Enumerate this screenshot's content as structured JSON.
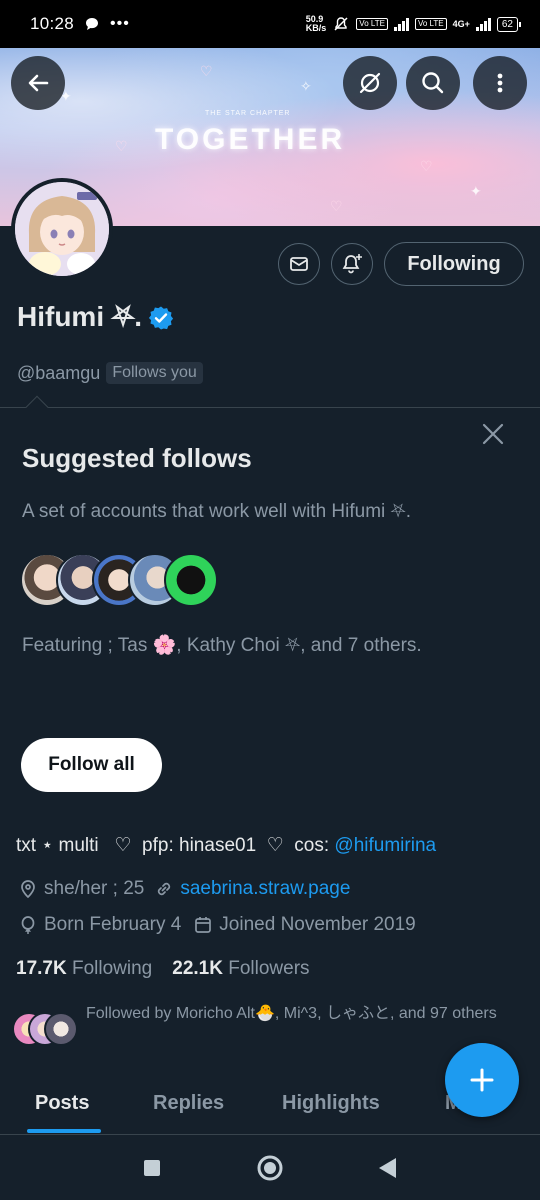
{
  "status_bar": {
    "time": "10:28",
    "net_speed_value": "50.9",
    "net_speed_unit": "KB/s",
    "volte_label": "Vo LTE",
    "network_type": "4G+",
    "battery": "62"
  },
  "banner": {
    "title": "TOGETHER",
    "subtitle": "THE STAR CHAPTER"
  },
  "profile": {
    "display_name": "Hifumi ⛧.",
    "handle": "@baamgu",
    "follows_you_label": "Follows you",
    "following_button_label": "Following"
  },
  "suggested": {
    "title": "Suggested follows",
    "description": "A set of accounts that work well with Hifumi ⛧.",
    "featuring": "Featuring ; Tas 🌸, Kathy Choi ⛧, and 7 others.",
    "follow_all_label": "Follow all"
  },
  "bio": {
    "part1": "txt ⋆ multi   ♡  pfp: hinase01  ♡  cos: ",
    "mention": "@hifumirina"
  },
  "meta": {
    "pronouns": "she/her ; 25",
    "website": "saebrina.straw.page",
    "birthday": "Born February 4",
    "joined": "Joined November 2019"
  },
  "counts": {
    "following_count": "17.7K",
    "following_label": "Following",
    "followers_count": "22.1K",
    "followers_label": "Followers"
  },
  "followed_by": {
    "text": "Followed by Moricho Alt🐣, Mi^3, しゃふと, and 97 others"
  },
  "tabs": [
    {
      "label": "Posts"
    },
    {
      "label": "Replies"
    },
    {
      "label": "Highlights"
    },
    {
      "label": "Media"
    }
  ],
  "colors": {
    "background": "#15202b",
    "accent": "#1d9bf0",
    "muted_text": "#8b98a5",
    "primary_text": "#e7e9ea"
  }
}
